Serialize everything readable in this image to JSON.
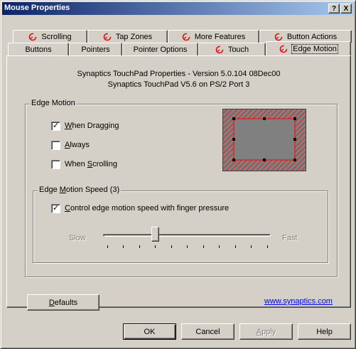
{
  "window": {
    "title": "Mouse Properties",
    "help_button": "?",
    "close_button": "X"
  },
  "tabs_row1": [
    {
      "label": "Scrolling",
      "icon": "synaptics-swirl-icon"
    },
    {
      "label": "Tap Zones",
      "icon": "synaptics-swirl-icon"
    },
    {
      "label": "More Features",
      "icon": "synaptics-swirl-icon"
    },
    {
      "label": "Button Actions",
      "icon": "synaptics-swirl-icon"
    }
  ],
  "tabs_row2": [
    {
      "label": "Buttons"
    },
    {
      "label": "Pointers"
    },
    {
      "label": "Pointer Options"
    },
    {
      "label": "Touch",
      "icon": "synaptics-swirl-icon"
    },
    {
      "label": "Edge Motion",
      "icon": "synaptics-swirl-icon",
      "active": true
    }
  ],
  "info": {
    "line1": "Synaptics TouchPad Properties - Version 5.0.104 08Dec00",
    "line2": "Synaptics TouchPad V5.6 on PS/2 Port 3"
  },
  "edge_motion": {
    "legend": "Edge Motion",
    "options": [
      {
        "label": "When Dragging",
        "checked": true,
        "mnemonic": "W"
      },
      {
        "label": "Always",
        "checked": false,
        "mnemonic": "A"
      },
      {
        "label": "When Scrolling",
        "checked": false,
        "mnemonic": "S"
      }
    ]
  },
  "speed": {
    "legend_pre": "Edge ",
    "legend_mnemonic": "M",
    "legend_post": "otion Speed (3)",
    "pressure_label": "Control edge motion speed with finger pressure",
    "pressure_checked": true,
    "slow_label": "Slow",
    "fast_label": "Fast",
    "slider_value": 3,
    "slider_max": 10
  },
  "buttons": {
    "defaults": "Defaults",
    "ok": "OK",
    "cancel": "Cancel",
    "apply": "Apply",
    "help": "Help"
  },
  "link": "www.synaptics.com",
  "colors": {
    "titlebar_start": "#0a246a",
    "titlebar_end": "#a6caf0",
    "face": "#d4d0c8",
    "link": "#0000ff",
    "edge_red": "#ff0000"
  }
}
